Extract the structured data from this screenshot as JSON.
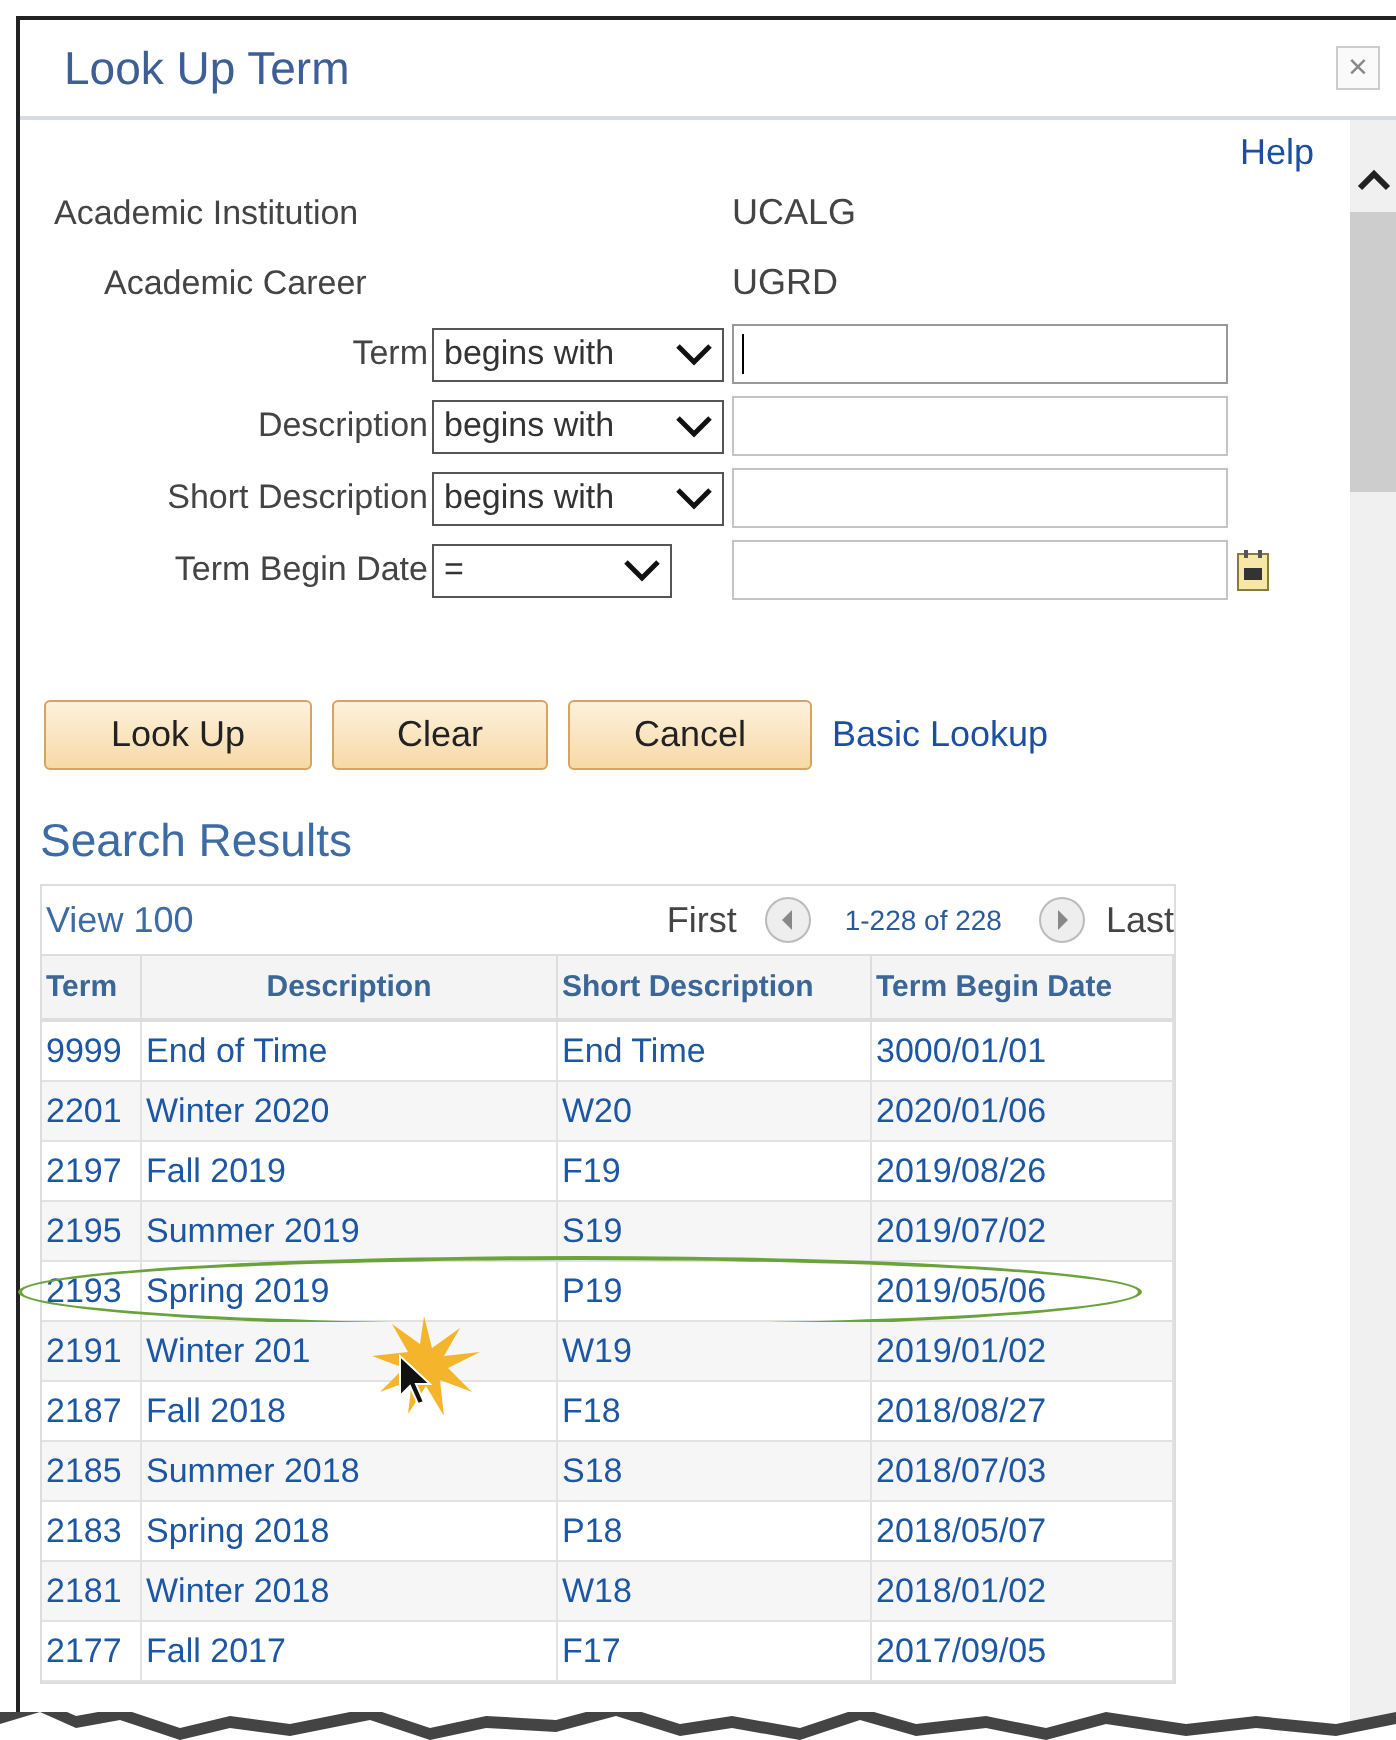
{
  "window": {
    "title": "Look Up Term",
    "close": "×"
  },
  "help": "Help",
  "display_fields": [
    {
      "label": "Academic Institution",
      "value": "UCALG"
    },
    {
      "label": "Academic Career",
      "value": "UGRD"
    }
  ],
  "search_fields": [
    {
      "label": "Term",
      "kind": "text",
      "operator": "begins with",
      "focused": true
    },
    {
      "label": "Description",
      "kind": "text",
      "operator": "begins with",
      "focused": false
    },
    {
      "label": "Short Description",
      "kind": "text",
      "operator": "begins with",
      "focused": false
    },
    {
      "label": "Term Begin Date",
      "kind": "date",
      "operator": "=",
      "focused": false
    }
  ],
  "buttons": [
    "Look Up",
    "Clear",
    "Cancel"
  ],
  "basic_lookup": "Basic Lookup",
  "results": {
    "title": "Search Results",
    "view": "View 100",
    "first": "First",
    "range": "1-228 of 228",
    "last": "Last",
    "columns": [
      "Term",
      "Description",
      "Short Description",
      "Term Begin Date"
    ],
    "rows": [
      {
        "cells": [
          "9999",
          "End of Time",
          "End Time",
          "3000/01/01"
        ],
        "highlighted": false
      },
      {
        "cells": [
          "2201",
          "Winter 2020",
          "W20",
          "2020/01/06"
        ],
        "highlighted": false
      },
      {
        "cells": [
          "2197",
          "Fall 2019",
          "F19",
          "2019/08/26"
        ],
        "highlighted": false
      },
      {
        "cells": [
          "2195",
          "Summer 2019",
          "S19",
          "2019/07/02"
        ],
        "highlighted": false
      },
      {
        "cells": [
          "2193",
          "Spring 2019",
          "P19",
          "2019/05/06"
        ],
        "highlighted": true
      },
      {
        "cells": [
          "2191",
          "Winter 201",
          "W19",
          "2019/01/02"
        ],
        "highlighted": false
      },
      {
        "cells": [
          "2187",
          "Fall 2018",
          "F18",
          "2018/08/27"
        ],
        "highlighted": false
      },
      {
        "cells": [
          "2185",
          "Summer 2018",
          "S18",
          "2018/07/03"
        ],
        "highlighted": false
      },
      {
        "cells": [
          "2183",
          "Spring 2018",
          "P18",
          "2018/05/07"
        ],
        "highlighted": false
      },
      {
        "cells": [
          "2181",
          "Winter 2018",
          "W18",
          "2018/01/02"
        ],
        "highlighted": false
      },
      {
        "cells": [
          "2177",
          "Fall 2017",
          "F17",
          "2017/09/05"
        ],
        "highlighted": false
      }
    ]
  }
}
